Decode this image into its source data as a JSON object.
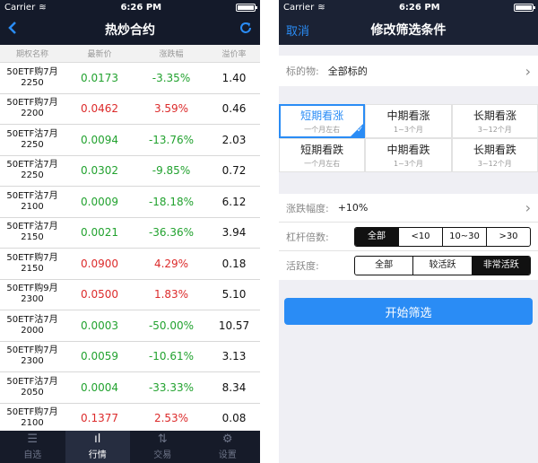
{
  "left": {
    "status": {
      "carrier": "Carrier",
      "time": "6:26 PM"
    },
    "title": "热炒合约",
    "columns": [
      "期权名称",
      "最新价",
      "涨跌幅",
      "溢价率"
    ],
    "rows": [
      {
        "name1": "50ETF购7月",
        "name2": "2250",
        "price": "0.0173",
        "change": "-3.35%",
        "premium": "1.40",
        "dir": "down"
      },
      {
        "name1": "50ETF购7月",
        "name2": "2200",
        "price": "0.0462",
        "change": "3.59%",
        "premium": "0.46",
        "dir": "up"
      },
      {
        "name1": "50ETF沽7月",
        "name2": "2250",
        "price": "0.0094",
        "change": "-13.76%",
        "premium": "2.03",
        "dir": "down"
      },
      {
        "name1": "50ETF沽7月",
        "name2": "2250",
        "price": "0.0302",
        "change": "-9.85%",
        "premium": "0.72",
        "dir": "down"
      },
      {
        "name1": "50ETF沽7月",
        "name2": "2100",
        "price": "0.0009",
        "change": "-18.18%",
        "premium": "6.12",
        "dir": "down"
      },
      {
        "name1": "50ETF沽7月",
        "name2": "2150",
        "price": "0.0021",
        "change": "-36.36%",
        "premium": "3.94",
        "dir": "down"
      },
      {
        "name1": "50ETF购7月",
        "name2": "2150",
        "price": "0.0900",
        "change": "4.29%",
        "premium": "0.18",
        "dir": "up"
      },
      {
        "name1": "50ETF购9月",
        "name2": "2300",
        "price": "0.0500",
        "change": "1.83%",
        "premium": "5.10",
        "dir": "up"
      },
      {
        "name1": "50ETF沽7月",
        "name2": "2000",
        "price": "0.0003",
        "change": "-50.00%",
        "premium": "10.57",
        "dir": "down"
      },
      {
        "name1": "50ETF购7月",
        "name2": "2300",
        "price": "0.0059",
        "change": "-10.61%",
        "premium": "3.13",
        "dir": "down"
      },
      {
        "name1": "50ETF沽7月",
        "name2": "2050",
        "price": "0.0004",
        "change": "-33.33%",
        "premium": "8.34",
        "dir": "down"
      },
      {
        "name1": "50ETF购7月",
        "name2": "2100",
        "price": "0.1377",
        "change": "2.53%",
        "premium": "0.08",
        "dir": "up"
      }
    ],
    "tabs": [
      {
        "label": "自选",
        "icon": "☰",
        "active": false
      },
      {
        "label": "行情",
        "icon": "ıl",
        "active": true
      },
      {
        "label": "交易",
        "icon": "⇅",
        "active": false
      },
      {
        "label": "设置",
        "icon": "⚙",
        "active": false
      }
    ]
  },
  "right": {
    "status": {
      "carrier": "Carrier",
      "time": "6:26 PM"
    },
    "cancel": "取消",
    "title": "修改筛选条件",
    "underlying": {
      "label": "标的物:",
      "value": "全部标的"
    },
    "terms": [
      {
        "title": "短期看涨",
        "sub": "一个月左右",
        "selected": true
      },
      {
        "title": "中期看涨",
        "sub": "1~3个月",
        "selected": false
      },
      {
        "title": "长期看涨",
        "sub": "3~12个月",
        "selected": false
      },
      {
        "title": "短期看跌",
        "sub": "一个月左右",
        "selected": false
      },
      {
        "title": "中期看跌",
        "sub": "1~3个月",
        "selected": false
      },
      {
        "title": "长期看跌",
        "sub": "3~12个月",
        "selected": false
      }
    ],
    "change_range": {
      "label": "涨跌幅度:",
      "value": "+10%"
    },
    "leverage": {
      "label": "杠杆倍数:",
      "options": [
        "全部",
        "<10",
        "10~30",
        ">30"
      ],
      "selected": 0
    },
    "activity": {
      "label": "活跃度:",
      "options": [
        "全部",
        "较活跃",
        "非常活跃"
      ],
      "selected": 2
    },
    "start_button": "开始筛选"
  }
}
